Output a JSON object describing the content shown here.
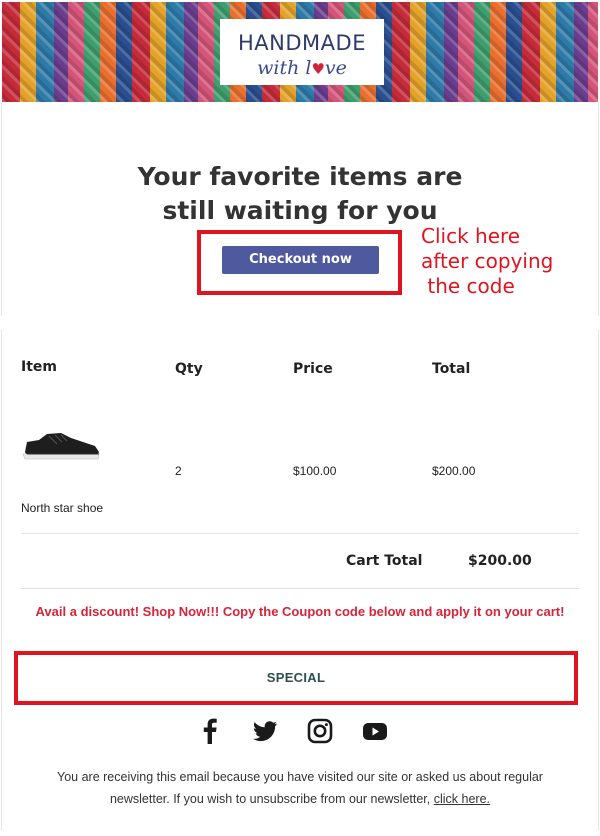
{
  "banner": {
    "logo_line1": "HANDMADE",
    "logo_line2_prefix": "with l",
    "logo_heart": "♥",
    "logo_line2_suffix": "ve"
  },
  "hero": {
    "title": "Your favorite items are still waiting for you",
    "checkout_label": "Checkout now"
  },
  "annotation": {
    "text": "Click here\nafter copying\n the code",
    "color": "#e0141e"
  },
  "cart": {
    "headers": [
      "Item",
      "Qty",
      "Price",
      "Total"
    ],
    "items": [
      {
        "name": "North star shoe",
        "qty": "2",
        "price": "$100.00",
        "total": "$200.00",
        "image_icon": "sneaker-image"
      }
    ],
    "cart_total_label": "Cart Total",
    "cart_total_value": "$200.00"
  },
  "promo": {
    "text": "Avail a discount! Shop Now!!! Copy the Coupon code below and apply it on your cart!",
    "color": "#d6243a"
  },
  "coupon": {
    "code": "SPECIAL"
  },
  "social": {
    "icons": [
      "facebook-icon",
      "twitter-icon",
      "instagram-icon",
      "youtube-icon"
    ]
  },
  "footer": {
    "text": "You are receiving this email because you have visited our site or asked us about regular newsletter. If you wish to unsubscribe from our newsletter,",
    "link_text": "click here."
  },
  "colors": {
    "button": "#4f5a9e",
    "accent_red": "#e0141e"
  }
}
